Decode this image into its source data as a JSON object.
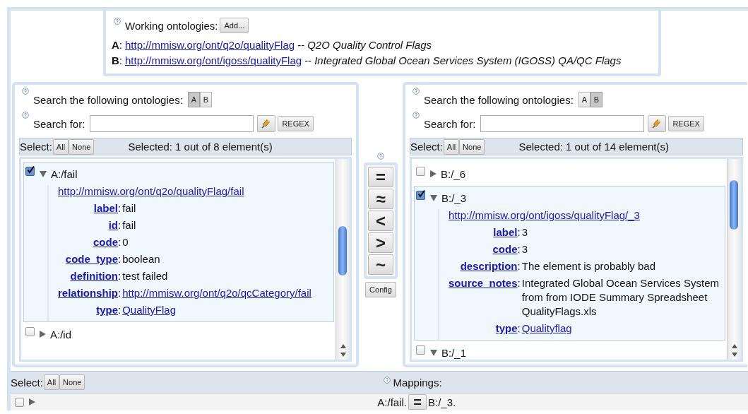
{
  "working_ontologies": {
    "label": "Working ontologies:",
    "add_button": "Add...",
    "ontologies": [
      {
        "key": "A",
        "colon": ":",
        "url": "http://mmisw.org/ont/q2o/qualityFlag",
        "dash": "--",
        "title": "Q2O Quality Control Flags"
      },
      {
        "key": "B",
        "colon": ":",
        "url": "http://mmisw.org/ont/igoss/qualityFlag",
        "dash": "--",
        "title": "Integrated Global Ocean Services System (IGOSS) QA/QC Flags"
      }
    ]
  },
  "panels": [
    {
      "search_label": "Search the following ontologies:",
      "ontology_toggles": [
        {
          "label": "A",
          "selected": true
        },
        {
          "label": "B",
          "selected": false
        }
      ],
      "search_for_label": "Search for:",
      "regex_button": "REGEX",
      "select_label": "Select:",
      "all_button": "All",
      "none_button": "None",
      "selected_count": "Selected: 1 out of 8 element(s)",
      "elements": [
        {
          "name": "A:/fail",
          "checked": true,
          "expanded": true,
          "uri": "http://mmisw.org/ont/q2o/qualityFlag/fail",
          "properties": [
            {
              "key": "label",
              "colon": ":",
              "value": "fail",
              "link": false
            },
            {
              "key": "id",
              "colon": ":",
              "value": "fail",
              "link": false
            },
            {
              "key": "code",
              "colon": ":",
              "value": "0",
              "link": false
            },
            {
              "key": "code_type",
              "colon": ":",
              "value": "boolean",
              "link": false
            },
            {
              "key": "definition",
              "colon": ":",
              "value": "test failed",
              "link": false
            },
            {
              "key": "relationship",
              "colon": ":",
              "value": "http://mmisw.org/ont/q2o/qcCategory/fail",
              "link": true
            },
            {
              "key": "type",
              "colon": ":",
              "value": "QualityFlag",
              "link": true
            }
          ]
        },
        {
          "name": "A:/id",
          "checked": false,
          "expanded": false
        }
      ]
    },
    {
      "search_label": "Search the following ontologies:",
      "ontology_toggles": [
        {
          "label": "A",
          "selected": false
        },
        {
          "label": "B",
          "selected": true
        }
      ],
      "search_for_label": "Search for:",
      "regex_button": "REGEX",
      "select_label": "Select:",
      "all_button": "All",
      "none_button": "None",
      "selected_count": "Selected: 1 out of 14 element(s)",
      "elements": [
        {
          "name": "B:/_6",
          "checked": false,
          "expanded": false
        },
        {
          "name": "B:/_3",
          "checked": true,
          "expanded": true,
          "uri": "http://mmisw.org/ont/igoss/qualityFlag/_3",
          "properties": [
            {
              "key": "label",
              "colon": ":",
              "value": "3",
              "link": false
            },
            {
              "key": "code",
              "colon": ":",
              "value": "3",
              "link": false
            },
            {
              "key": "description",
              "colon": ":",
              "value": "The element is probably bad",
              "link": false
            },
            {
              "key": "source_notes",
              "colon": ":",
              "value": "Integrated Global Ocean Services System from from IODE Summary Spreadsheet QualityFlags.xls",
              "link": false
            },
            {
              "key": "type",
              "colon": ":",
              "value": "Qualityflag",
              "link": true
            }
          ]
        },
        {
          "name": "B:/_1",
          "checked": false,
          "expanded": true
        }
      ]
    }
  ],
  "mapping_buttons": [
    "=",
    "≈",
    "<",
    ">",
    "~"
  ],
  "config_button": "Config",
  "mappings": {
    "select_label": "Select:",
    "all_button": "All",
    "none_button": "None",
    "title": "Mappings:",
    "rows": [
      {
        "checked": false,
        "expanded": false,
        "left": "A:/fail.",
        "relation": "=",
        "right": "B:/_3."
      }
    ]
  }
}
